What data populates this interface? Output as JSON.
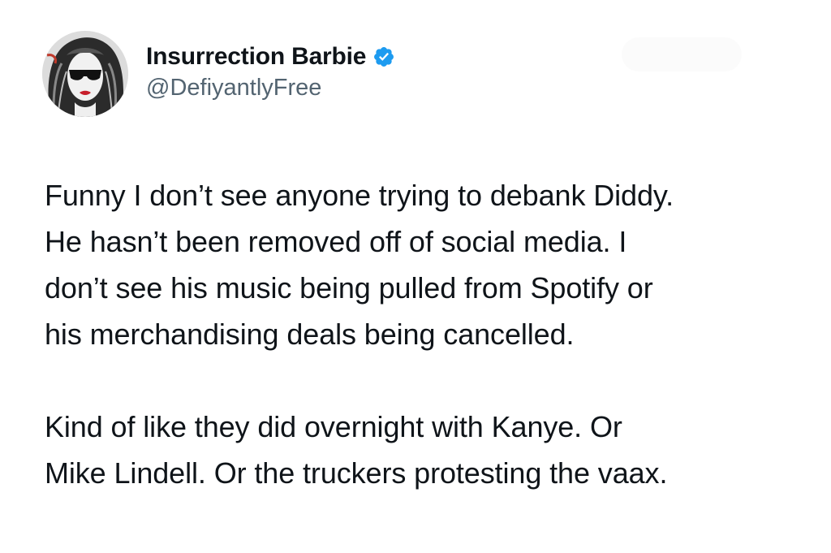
{
  "tweet": {
    "author": {
      "display_name": "Insurrection Barbie",
      "handle": "@DefiyantlyFree",
      "verified": true,
      "verified_icon": "verified-badge-icon",
      "accent_color": "#1d9bf0"
    },
    "follow_button_label": "",
    "paragraphs": [
      {
        "lines": [
          "Funny I don’t see anyone trying to debank Diddy.",
          "He hasn’t been removed off of social media. I",
          "don’t see his music being pulled from Spotify or",
          "his merchandising deals being cancelled."
        ]
      },
      {
        "lines": [
          "Kind of like they did overnight with Kanye. Or",
          "Mike Lindell. Or the truckers protesting the vaax."
        ]
      }
    ]
  }
}
